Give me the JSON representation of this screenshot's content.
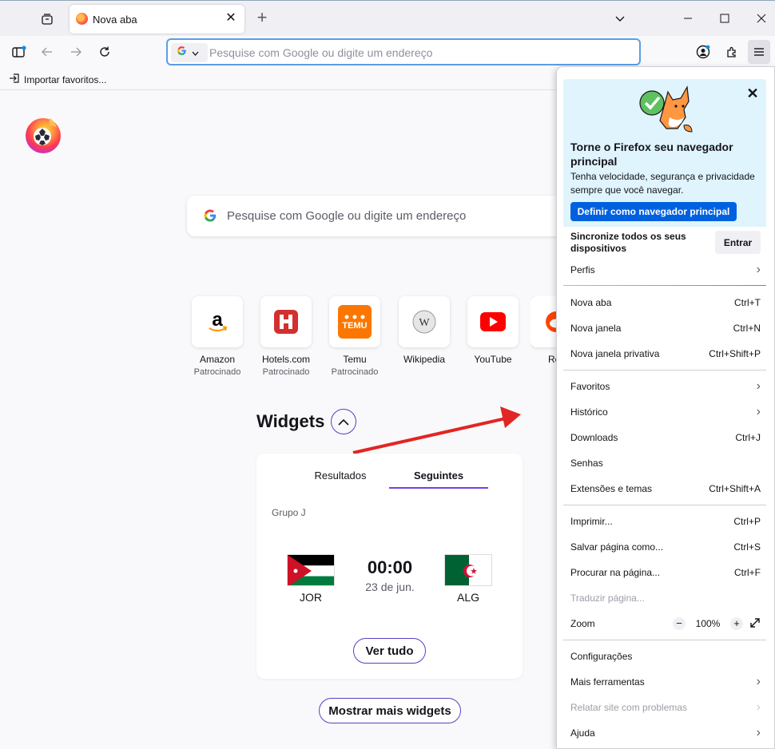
{
  "tab": {
    "title": "Nova aba"
  },
  "urlbar": {
    "placeholder": "Pesquise com Google ou digite um endereço"
  },
  "bookmarks": {
    "import_label": "Importar favoritos..."
  },
  "newtab": {
    "search_placeholder": "Pesquise com Google ou digite um endereço",
    "shortcuts": [
      {
        "name": "Amazon",
        "sub": "Patrocinado"
      },
      {
        "name": "Hotels.com",
        "sub": "Patrocinado"
      },
      {
        "name": "Temu",
        "sub": "Patrocinado"
      },
      {
        "name": "Wikipedia",
        "sub": ""
      },
      {
        "name": "YouTube",
        "sub": ""
      },
      {
        "name": "Re",
        "sub": ""
      }
    ],
    "widgets_title": "Widgets",
    "widget": {
      "tabs": [
        "Resultados",
        "Seguintes"
      ],
      "group": "Grupo J",
      "home_team": "JOR",
      "away_team": "ALG",
      "time": "00:00",
      "date": "23 de jun.",
      "see_all": "Ver tudo"
    },
    "more_widgets": "Mostrar mais widgets"
  },
  "menu": {
    "promo": {
      "title": "Torne o Firefox seu navegador principal",
      "body": "Tenha velocidade, segurança e privacidade sempre que você navegar.",
      "button": "Definir como navegador principal"
    },
    "sync": {
      "text": "Sincronize todos os seus dispositivos",
      "button": "Entrar"
    },
    "profiles": "Perfis",
    "items": {
      "new_tab": {
        "label": "Nova aba",
        "shortcut": "Ctrl+T"
      },
      "new_window": {
        "label": "Nova janela",
        "shortcut": "Ctrl+N"
      },
      "private_window": {
        "label": "Nova janela privativa",
        "shortcut": "Ctrl+Shift+P"
      },
      "bookmarks": {
        "label": "Favoritos"
      },
      "history": {
        "label": "Histórico"
      },
      "downloads": {
        "label": "Downloads",
        "shortcut": "Ctrl+J"
      },
      "passwords": {
        "label": "Senhas"
      },
      "addons": {
        "label": "Extensões e temas",
        "shortcut": "Ctrl+Shift+A"
      },
      "print": {
        "label": "Imprimir...",
        "shortcut": "Ctrl+P"
      },
      "save_page": {
        "label": "Salvar página como...",
        "shortcut": "Ctrl+S"
      },
      "find": {
        "label": "Procurar na página...",
        "shortcut": "Ctrl+F"
      },
      "translate": {
        "label": "Traduzir página..."
      },
      "zoom": {
        "label": "Zoom",
        "minus": "−",
        "value": "100%",
        "plus": "+"
      },
      "settings": {
        "label": "Configurações"
      },
      "more_tools": {
        "label": "Mais ferramentas"
      },
      "report": {
        "label": "Relatar site com problemas"
      },
      "help": {
        "label": "Ajuda"
      }
    }
  },
  "colors": {
    "accent": "#0061e0",
    "purple": "#5b3ec2",
    "arrow": "#e22525"
  }
}
